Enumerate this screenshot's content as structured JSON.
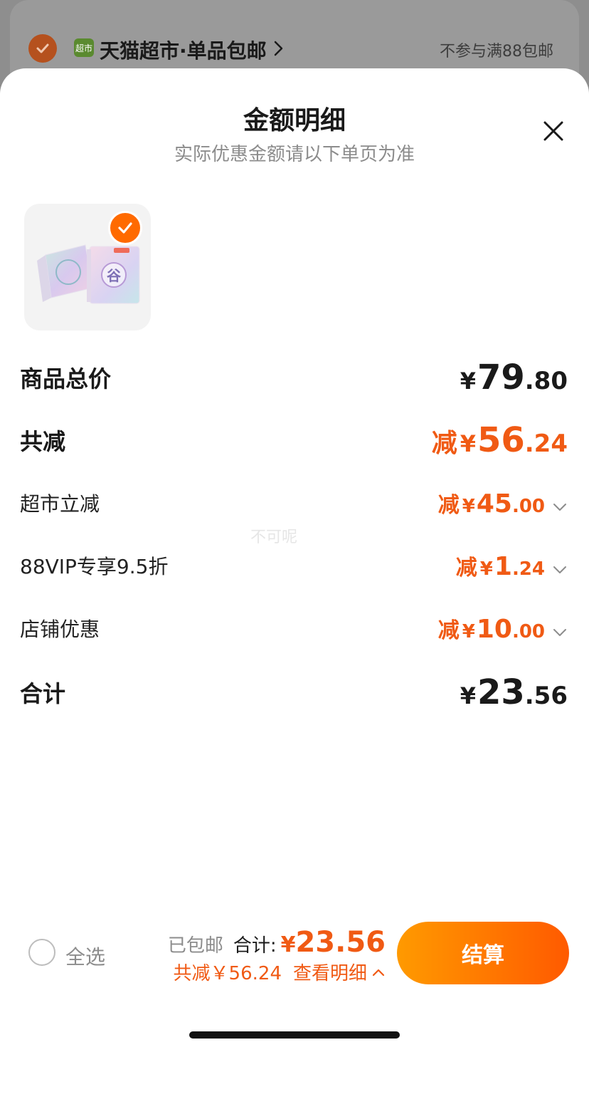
{
  "background": {
    "store_logo_text": "超市",
    "store_name": "天猫超市·单品包邮",
    "shipping_note": "不参与满88包邮"
  },
  "sheet": {
    "title": "金额明细",
    "subtitle": "实际优惠金额请以下单页为准",
    "product_image_text": "谷",
    "watermark": "不可呢",
    "rows": {
      "subtotal": {
        "label": "商品总价",
        "yen": "¥",
        "int": "79",
        "dec": ".80"
      },
      "total_discount": {
        "label": "共减",
        "prefix": "减",
        "yen": "¥",
        "int": "56",
        "dec": ".24"
      },
      "discount_1": {
        "label": "超市立减",
        "prefix": "减",
        "yen": "¥",
        "int": "45",
        "dec": ".00"
      },
      "discount_2": {
        "label": "88VIP专享9.5折",
        "prefix": "减",
        "yen": "¥",
        "int": "1",
        "dec": ".24"
      },
      "discount_3": {
        "label": "店铺优惠",
        "prefix": "减",
        "yen": "¥",
        "int": "10",
        "dec": ".00"
      },
      "total": {
        "label": "合计",
        "yen": "¥",
        "int": "23",
        "dec": ".56"
      }
    }
  },
  "bottom_bar": {
    "select_all": "全选",
    "shipping": "已包邮",
    "total_label": "合计:",
    "total_yen": "¥",
    "total_value": "23.56",
    "discount_text": "共减￥56.24",
    "detail_link": "查看明细",
    "checkout": "结算"
  },
  "colors": {
    "accent": "#f05a14",
    "checkout_gradient_start": "#ff9a00",
    "checkout_gradient_end": "#ff5a00"
  }
}
